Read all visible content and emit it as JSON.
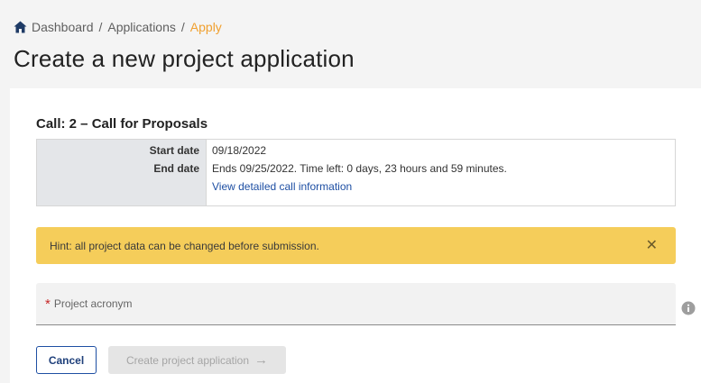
{
  "breadcrumb": {
    "home_icon": "home-icon",
    "items": [
      "Dashboard",
      "Applications",
      "Apply"
    ],
    "separator": "/",
    "current_color": "#f0a030"
  },
  "page": {
    "title": "Create a new project application"
  },
  "call": {
    "title": "Call: 2 – Call for Proposals",
    "rows": [
      {
        "label": "Start date",
        "value": "09/18/2022"
      },
      {
        "label": "End date",
        "value": "Ends 09/25/2022. Time left: 0 days, 23 hours and 59 minutes."
      }
    ],
    "details_link": "View detailed call information"
  },
  "hint": {
    "text": "Hint: all project data can be changed before submission.",
    "close_icon": "close-icon",
    "background": "#f5cd5a"
  },
  "form": {
    "acronym_required_mark": "*",
    "acronym_placeholder": "Project acronym",
    "info_icon": "info-icon"
  },
  "actions": {
    "cancel_label": "Cancel",
    "create_label": "Create project application",
    "create_arrow": "→",
    "create_disabled": true
  },
  "colors": {
    "primary": "#1e4fa3",
    "accent": "#f0a030"
  }
}
